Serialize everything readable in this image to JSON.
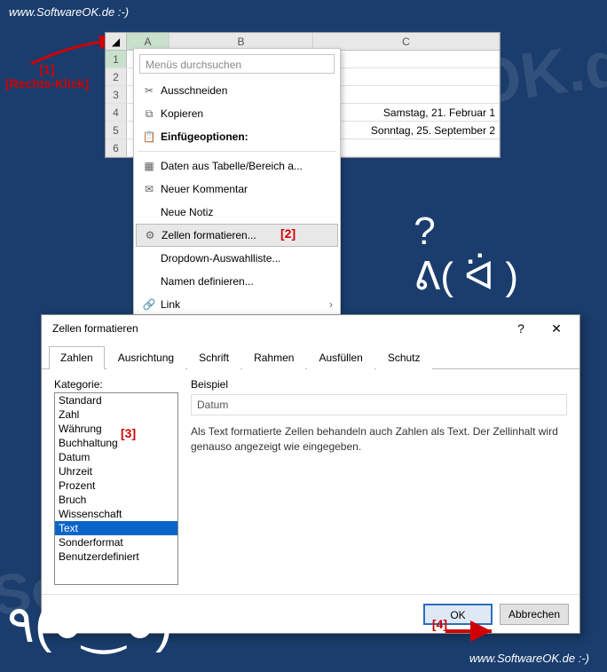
{
  "branding": {
    "url_top": "www.SoftwareOK.de :-)",
    "url_bottom": "www.SoftwareOK.de :-)",
    "watermark": "SoftwareOK.de"
  },
  "annotations": {
    "a1_num": "[1]",
    "a1_label": "[Rechts-Klick]",
    "a2": "[2]",
    "a3": "[3]",
    "a4": "[4]"
  },
  "spreadsheet": {
    "cols": {
      "A": "A",
      "B": "B",
      "C": "C"
    },
    "rows": [
      "1",
      "2",
      "3",
      "4",
      "5",
      "6"
    ],
    "data": {
      "c4": "Samstag, 21. Februar 1",
      "c5": "Sonntag, 25. September 2"
    }
  },
  "context_menu": {
    "search_placeholder": "Menüs durchsuchen",
    "items": [
      {
        "label": "Ausschneiden",
        "icon": "✂"
      },
      {
        "label": "Kopieren",
        "icon": "⧉"
      },
      {
        "label": "Einfügeoptionen:",
        "icon": "📋",
        "bold": true
      }
    ],
    "items2": [
      {
        "label": "Daten aus Tabelle/Bereich a...",
        "icon": "▦"
      },
      {
        "label": "Neuer Kommentar",
        "icon": "✉"
      },
      {
        "label": "Neue Notiz",
        "icon": ""
      },
      {
        "label": "Zellen formatieren...",
        "icon": "⚙",
        "highlighted": true
      },
      {
        "label": "Dropdown-Auswahlliste...",
        "icon": ""
      },
      {
        "label": "Namen definieren...",
        "icon": ""
      },
      {
        "label": "Link",
        "icon": "🔗",
        "submenu": true
      }
    ]
  },
  "dialog": {
    "title": "Zellen formatieren",
    "tabs": [
      "Zahlen",
      "Ausrichtung",
      "Schrift",
      "Rahmen",
      "Ausfüllen",
      "Schutz"
    ],
    "active_tab": 0,
    "category_label": "Kategorie:",
    "categories": [
      "Standard",
      "Zahl",
      "Währung",
      "Buchhaltung",
      "Datum",
      "Uhrzeit",
      "Prozent",
      "Bruch",
      "Wissenschaft",
      "Text",
      "Sonderformat",
      "Benutzerdefiniert"
    ],
    "selected_category": "Text",
    "sample_label": "Beispiel",
    "sample_value": "Datum",
    "description": "Als Text formatierte Zellen behandeln auch Zahlen als Text. Der Zellinhalt wird genauso angezeigt wie eingegeben.",
    "ok": "OK",
    "cancel": "Abbrechen"
  }
}
